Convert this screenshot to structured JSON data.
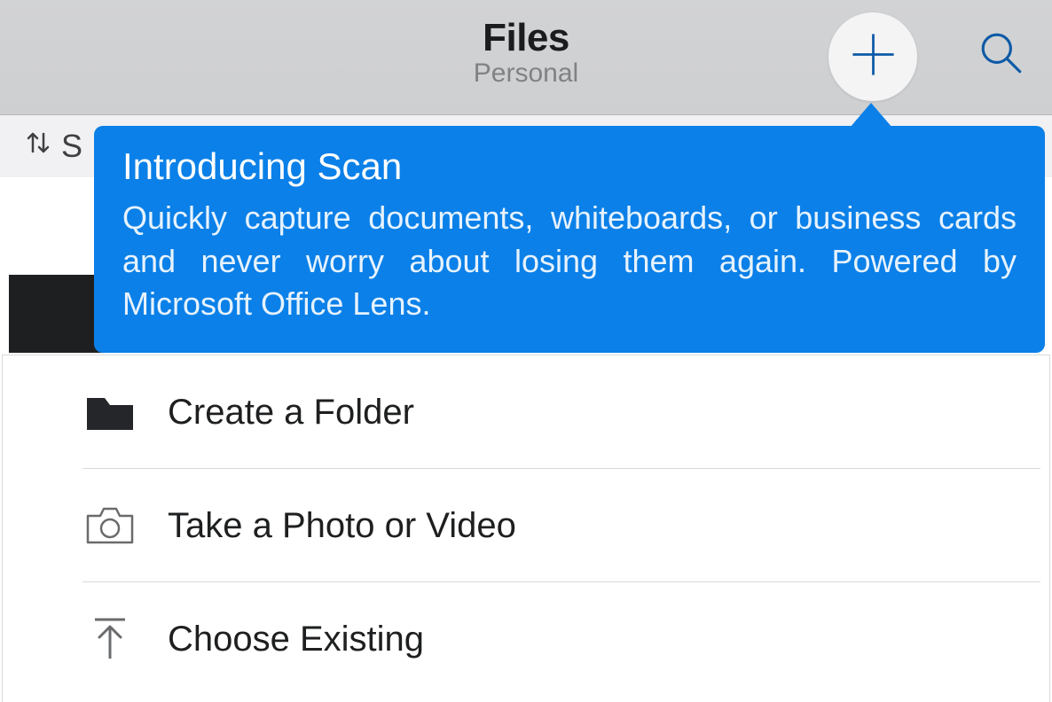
{
  "header": {
    "title": "Files",
    "subtitle": "Personal"
  },
  "sort": {
    "label_partial": "S"
  },
  "tooltip": {
    "title": "Introducing Scan",
    "body": "Quickly capture documents, whiteboards, or business cards and never worry about losing them again. Powered by Microsoft Office Lens."
  },
  "menu": {
    "items": [
      {
        "label": "Create a Folder"
      },
      {
        "label": "Take a Photo or Video"
      },
      {
        "label": "Choose Existing"
      }
    ]
  },
  "colors": {
    "accent": "#0b80e8",
    "icon_blue": "#0d5aa6"
  }
}
